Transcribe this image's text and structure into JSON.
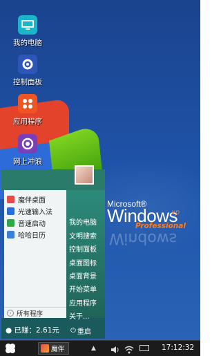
{
  "desktop": {
    "icons": [
      {
        "label": "我的电脑",
        "icon": "computer-icon"
      },
      {
        "label": "控制面板",
        "icon": "gear-icon"
      },
      {
        "label": "应用程序",
        "icon": "apps-icon"
      },
      {
        "label": "网上冲浪",
        "icon": "browser-icon"
      }
    ],
    "logo": {
      "microsoft": "Microsoft®",
      "windows": "Windows",
      "xp": "xp",
      "professional": "Professional",
      "reflection": "Windows"
    }
  },
  "start_menu": {
    "left_items": [
      {
        "label": "魔伴桌面",
        "color": "#e84a4a"
      },
      {
        "label": "光速输入法",
        "color": "#2a6fd6"
      },
      {
        "label": "音速启动",
        "color": "#2aa84a"
      },
      {
        "label": "哈哈日历",
        "color": "#3a7fd6"
      }
    ],
    "all_programs": "所有程序",
    "right_links": [
      "我的电脑",
      "文明搜索",
      "控制面板",
      "桌面图标",
      "桌面背景",
      "开始菜单",
      "应用程序",
      "关于..."
    ],
    "earned": "已赚：2.61元",
    "restart": "重启"
  },
  "taskbar": {
    "start_icon": "clover-icon",
    "app_label": "魔伴",
    "clock": "17:12:32"
  }
}
